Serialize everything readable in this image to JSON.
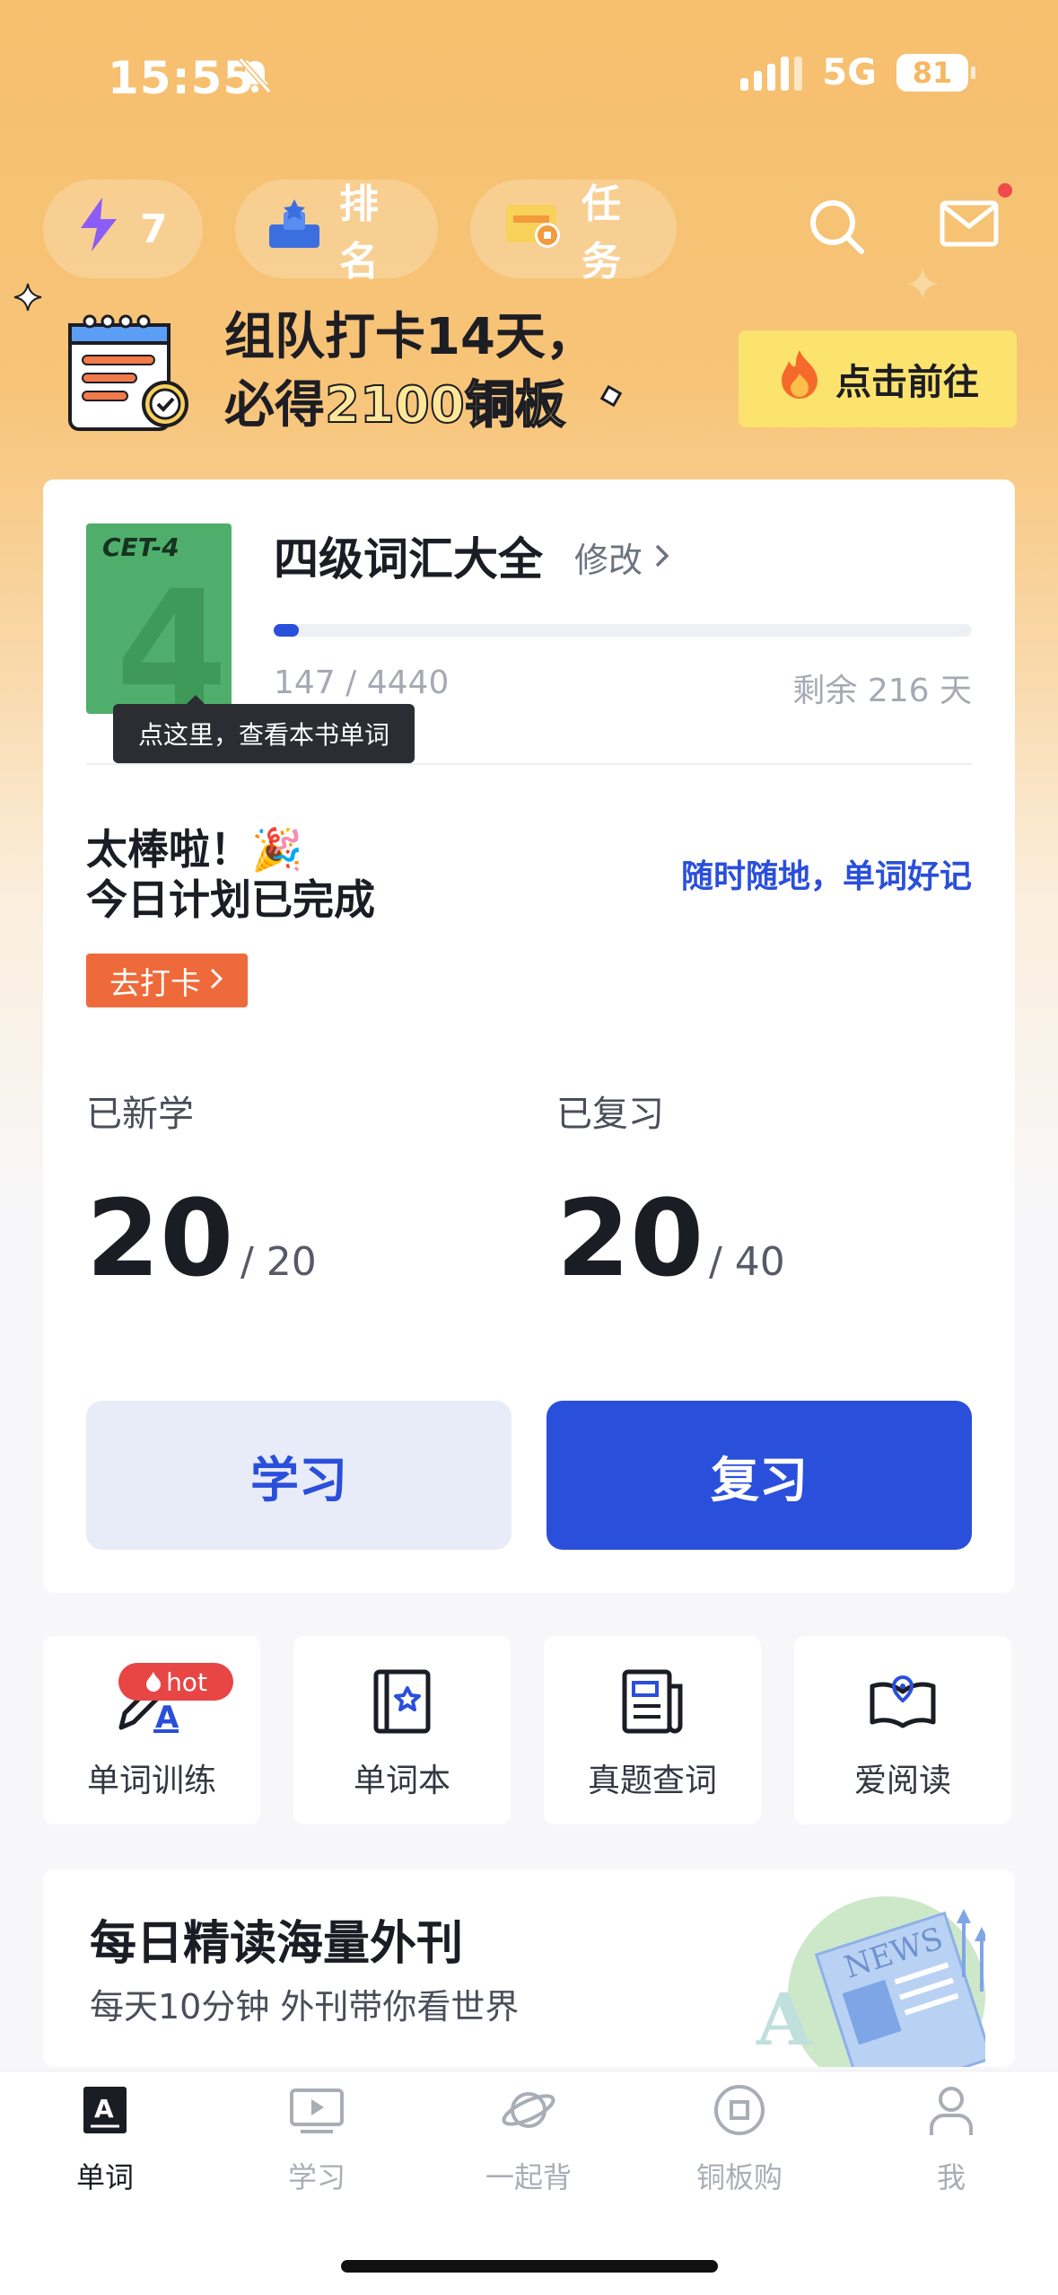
{
  "status": {
    "time": "15:55",
    "network": "5G",
    "battery": "81"
  },
  "top": {
    "energy_count": "7",
    "ranking_label": "排名",
    "tasks_label": "任务"
  },
  "banner": {
    "line1": "组队打卡14天，",
    "line2_prefix": "必得",
    "line2_highlight": "2100铜板",
    "cta": "点击前往"
  },
  "book": {
    "cover_text": "CET-4",
    "cover_number": "4",
    "title": "四级词汇大全",
    "modify_label": "修改",
    "progress_done": 147,
    "progress_total": 4440,
    "progress_text": "147 / 4440",
    "remaining_text": "剩余 216 天",
    "tooltip": "点这里，查看本书单词"
  },
  "today": {
    "line1": "太棒啦！🎉",
    "line2": "今日计划已完成",
    "slogan": "随时随地，单词好记",
    "checkin_label": "去打卡"
  },
  "stats": {
    "new_label": "已新学",
    "new_value": "20",
    "new_total": "/  20",
    "review_label": "已复习",
    "review_value": "20",
    "review_total": "/  40"
  },
  "actions": {
    "learn": "学习",
    "review": "复习"
  },
  "tools": [
    {
      "label": "单词训练",
      "badge": "hot"
    },
    {
      "label": "单词本"
    },
    {
      "label": "真题查词"
    },
    {
      "label": "爱阅读"
    }
  ],
  "news": {
    "title": "每日精读海量外刊",
    "subtitle": "每天10分钟 外刊带你看世界",
    "art_text": "NEWS"
  },
  "tabs": [
    {
      "label": "单词",
      "active": true
    },
    {
      "label": "学习"
    },
    {
      "label": "一起背"
    },
    {
      "label": "铜板购"
    },
    {
      "label": "我"
    }
  ],
  "colors": {
    "accent": "#2a4fdb",
    "banner_bg": "#f6bf6e",
    "checkin": "#ef6a3a",
    "cta_bg": "#fbe36e"
  }
}
